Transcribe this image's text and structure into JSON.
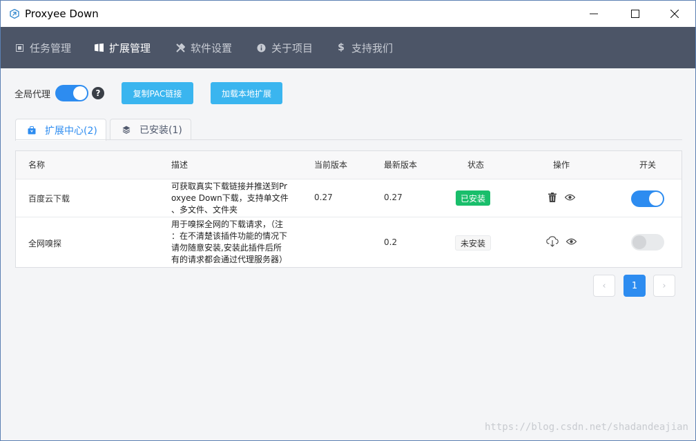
{
  "window": {
    "title": "Proxyee Down",
    "controls": [
      "minimize-icon",
      "maximize-icon",
      "close-icon"
    ]
  },
  "nav": {
    "items": [
      {
        "label": "任务管理",
        "icon": "task-icon",
        "active": false
      },
      {
        "label": "扩展管理",
        "icon": "extension-icon",
        "active": true
      },
      {
        "label": "软件设置",
        "icon": "wrench-icon",
        "active": false
      },
      {
        "label": "关于项目",
        "icon": "info-icon",
        "active": false
      },
      {
        "label": "支持我们",
        "icon": "dollar-icon",
        "active": false
      }
    ]
  },
  "toolbar": {
    "global_proxy_label": "全局代理",
    "global_proxy_enabled": true,
    "help_glyph": "?",
    "copy_pac_label": "复制PAC链接",
    "load_local_label": "加载本地扩展"
  },
  "tabs": [
    {
      "label": "扩展中心(2)",
      "icon": "shopping-bag-icon",
      "active": true
    },
    {
      "label": "已安装(1)",
      "icon": "layers-icon",
      "active": false
    }
  ],
  "table": {
    "columns": [
      "名称",
      "描述",
      "当前版本",
      "最新版本",
      "状态",
      "操作",
      "开关"
    ],
    "rows": [
      {
        "name": "百度云下载",
        "description_lines": [
          "可获取真实下载链接并推送到Pr",
          "oxyee Down下载，支持单文件",
          "、多文件、文件夹"
        ],
        "current_version": "0.27",
        "latest_version": "0.27",
        "status": "已安装",
        "actions": [
          "trash-icon",
          "eye-icon"
        ],
        "enabled": true
      },
      {
        "name": "全网嗅探",
        "description_lines": [
          "用于嗅探全网的下载请求，（注",
          "：在不清楚该插件功能的情况下",
          "请勿随意安装,安装此插件后所",
          "有的请求都会通过代理服务器）"
        ],
        "current_version": "",
        "latest_version": "0.2",
        "status": "未安装",
        "actions": [
          "cloud-download-icon",
          "eye-icon"
        ],
        "enabled": false
      }
    ]
  },
  "pagination": {
    "prev": "‹",
    "current": "1",
    "next": "›"
  },
  "watermark": "https://blog.csdn.net/shadandeajian",
  "colors": {
    "navbar": "#4c5567",
    "primary": "#2d8cf0",
    "button": "#3ab5ef",
    "success": "#19be6b"
  }
}
